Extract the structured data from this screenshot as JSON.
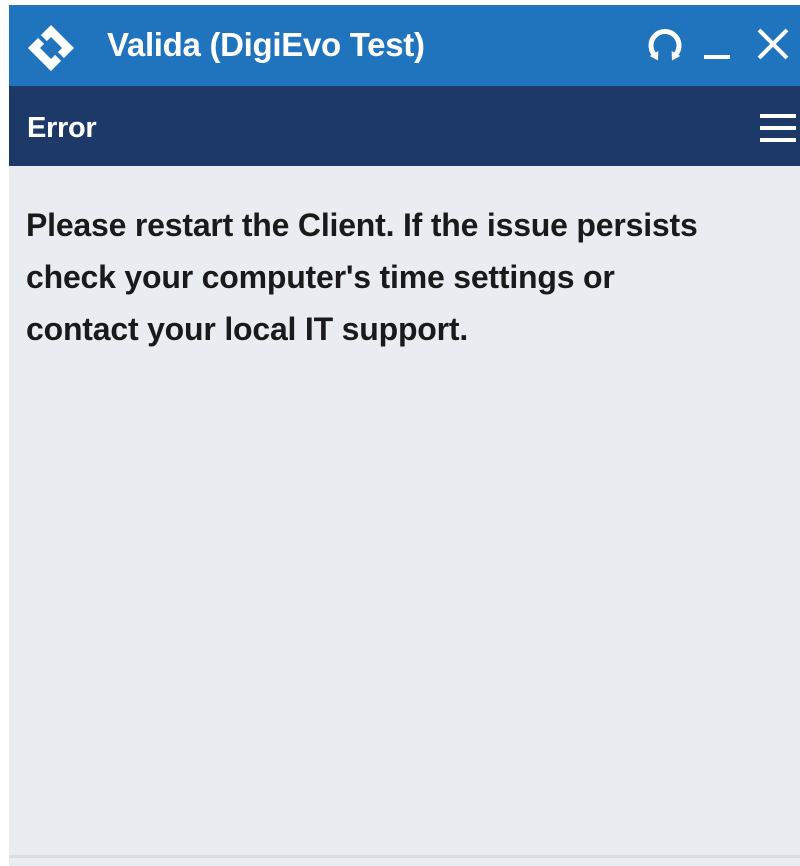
{
  "window": {
    "title": "Valida (DigiEvo Test)",
    "controls": {
      "refresh_icon": "refresh-icon",
      "minimize_icon": "minimize-icon",
      "close_icon": "close-icon"
    }
  },
  "subheader": {
    "title": "Error",
    "menu_icon": "hamburger-menu-icon"
  },
  "message": {
    "lines": [
      "Please restart the Client. If the issue persists",
      "check your computer's time settings or",
      "contact your local IT support."
    ]
  },
  "colors": {
    "titlebar": "#1f74bd",
    "subheader": "#1c3967",
    "content_bg": "#e9edf1",
    "text": "#1a1a1a"
  }
}
